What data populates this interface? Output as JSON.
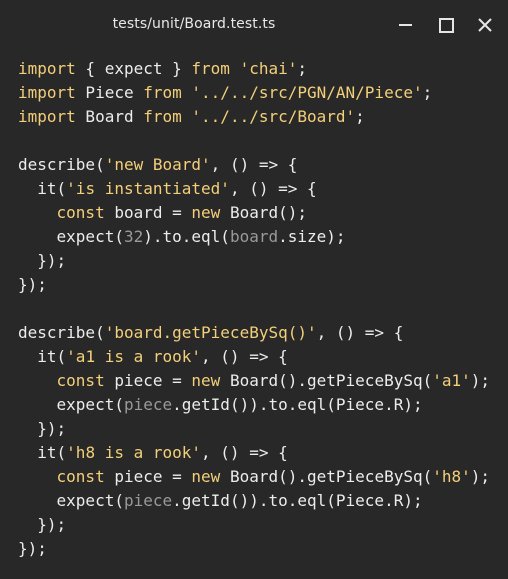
{
  "window": {
    "title": "tests/unit/Board.test.ts",
    "minimize_icon": "minimize-icon",
    "maximize_icon": "maximize-icon",
    "close_icon": "close-icon"
  },
  "colors": {
    "background": "#282828",
    "keyword": "#f3cf7a",
    "string": "#f3cf7a",
    "plain": "#ececec",
    "dim": "#9a9a9a"
  },
  "code": {
    "lines": [
      [
        [
          "kw",
          "import"
        ],
        [
          "pl",
          " { expect } "
        ],
        [
          "kw",
          "from"
        ],
        [
          "pl",
          " "
        ],
        [
          "str",
          "'chai'"
        ],
        [
          "pl",
          ";"
        ]
      ],
      [
        [
          "kw",
          "import"
        ],
        [
          "pl",
          " Piece "
        ],
        [
          "kw",
          "from"
        ],
        [
          "pl",
          " "
        ],
        [
          "str",
          "'../../src/PGN/AN/Piece'"
        ],
        [
          "pl",
          ";"
        ]
      ],
      [
        [
          "kw",
          "import"
        ],
        [
          "pl",
          " Board "
        ],
        [
          "kw",
          "from"
        ],
        [
          "pl",
          " "
        ],
        [
          "str",
          "'../../src/Board'"
        ],
        [
          "pl",
          ";"
        ]
      ],
      [],
      [
        [
          "pl",
          "describe("
        ],
        [
          "str",
          "'new Board'"
        ],
        [
          "pl",
          ", () => {"
        ]
      ],
      [
        [
          "pl",
          "  it("
        ],
        [
          "str",
          "'is instantiated'"
        ],
        [
          "pl",
          ", () => {"
        ]
      ],
      [
        [
          "pl",
          "    "
        ],
        [
          "kw",
          "const"
        ],
        [
          "pl",
          " board = "
        ],
        [
          "kw",
          "new"
        ],
        [
          "pl",
          " Board();"
        ]
      ],
      [
        [
          "pl",
          "    expect("
        ],
        [
          "num",
          "32"
        ],
        [
          "pl",
          ").to.eql("
        ],
        [
          "dim",
          "board"
        ],
        [
          "pl",
          ".size);"
        ]
      ],
      [
        [
          "pl",
          "  });"
        ]
      ],
      [
        [
          "pl",
          "});"
        ]
      ],
      [],
      [
        [
          "pl",
          "describe("
        ],
        [
          "str",
          "'board.getPieceBySq()'"
        ],
        [
          "pl",
          ", () => {"
        ]
      ],
      [
        [
          "pl",
          "  it("
        ],
        [
          "str",
          "'a1 is a rook'"
        ],
        [
          "pl",
          ", () => {"
        ]
      ],
      [
        [
          "pl",
          "    "
        ],
        [
          "kw",
          "const"
        ],
        [
          "pl",
          " piece = "
        ],
        [
          "kw",
          "new"
        ],
        [
          "pl",
          " Board().getPieceBySq("
        ],
        [
          "str",
          "'a1'"
        ],
        [
          "pl",
          ");"
        ]
      ],
      [
        [
          "pl",
          "    expect("
        ],
        [
          "dim",
          "piece"
        ],
        [
          "pl",
          ".getId()).to.eql(Piece.R);"
        ]
      ],
      [
        [
          "pl",
          "  });"
        ]
      ],
      [
        [
          "pl",
          "  it("
        ],
        [
          "str",
          "'h8 is a rook'"
        ],
        [
          "pl",
          ", () => {"
        ]
      ],
      [
        [
          "pl",
          "    "
        ],
        [
          "kw",
          "const"
        ],
        [
          "pl",
          " piece = "
        ],
        [
          "kw",
          "new"
        ],
        [
          "pl",
          " Board().getPieceBySq("
        ],
        [
          "str",
          "'h8'"
        ],
        [
          "pl",
          ");"
        ]
      ],
      [
        [
          "pl",
          "    expect("
        ],
        [
          "dim",
          "piece"
        ],
        [
          "pl",
          ".getId()).to.eql(Piece.R);"
        ]
      ],
      [
        [
          "pl",
          "  });"
        ]
      ],
      [
        [
          "pl",
          "});"
        ]
      ]
    ]
  }
}
